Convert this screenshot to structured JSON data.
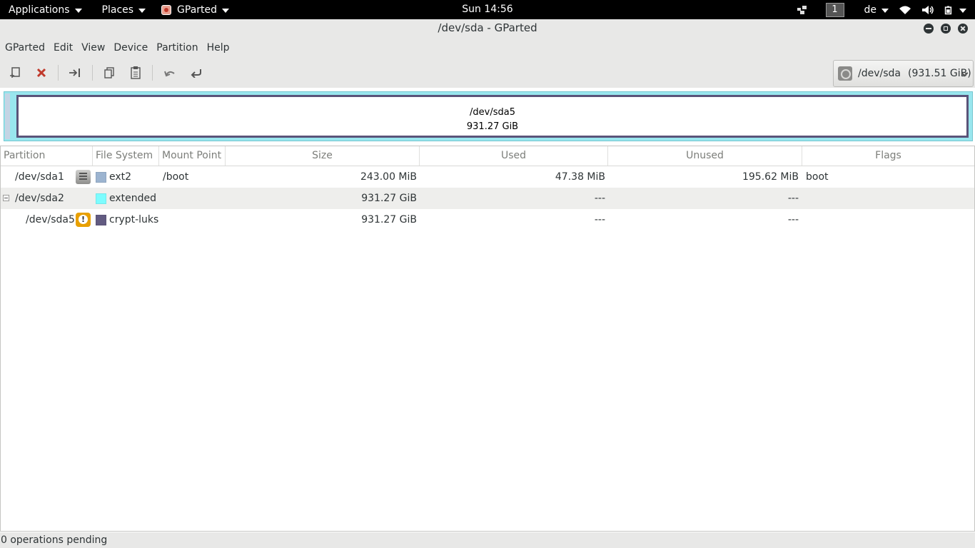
{
  "topbar": {
    "applications": "Applications",
    "places": "Places",
    "app_name": "GParted",
    "clock": "Sun 14:56",
    "workspace": "1",
    "keyboard_layout": "de"
  },
  "window": {
    "title": "/dev/sda - GParted"
  },
  "menu": [
    "GParted",
    "Edit",
    "View",
    "Device",
    "Partition",
    "Help"
  ],
  "toolbar": {
    "icons": [
      "new-partition-icon",
      "delete-icon",
      "resize-move-icon",
      "copy-icon",
      "paste-icon",
      "undo-icon",
      "apply-icon"
    ],
    "device_name": "/dev/sda",
    "device_size": "(931.51 GiB)"
  },
  "diskmap": {
    "partition": "/dev/sda5",
    "size": "931.27 GiB",
    "colors": {
      "extended": "#99e6ee",
      "crypt_luks": "#5a5379"
    }
  },
  "table": {
    "headers": {
      "partition": "Partition",
      "filesystem": "File System",
      "mountpoint": "Mount Point",
      "size": "Size",
      "used": "Used",
      "unused": "Unused",
      "flags": "Flags"
    },
    "rows": [
      {
        "partition": "/dev/sda1",
        "icon": "mounted-icon",
        "fs": "ext2",
        "fs_color": "#9cb4d0",
        "mount": "/boot",
        "size": "243.00 MiB",
        "used": "47.38 MiB",
        "unused": "195.62 MiB",
        "flags": "boot"
      },
      {
        "partition": "/dev/sda2",
        "icon": "",
        "fs": "extended",
        "fs_color": "#7dfcfe",
        "mount": "",
        "size": "931.27 GiB",
        "used": "---",
        "unused": "---",
        "flags": ""
      },
      {
        "partition": "/dev/sda5",
        "icon": "warning-icon",
        "fs": "crypt-luks",
        "fs_color": "#625b81",
        "mount": "",
        "size": "931.27 GiB",
        "used": "---",
        "unused": "---",
        "flags": ""
      }
    ]
  },
  "status": "0 operations pending"
}
